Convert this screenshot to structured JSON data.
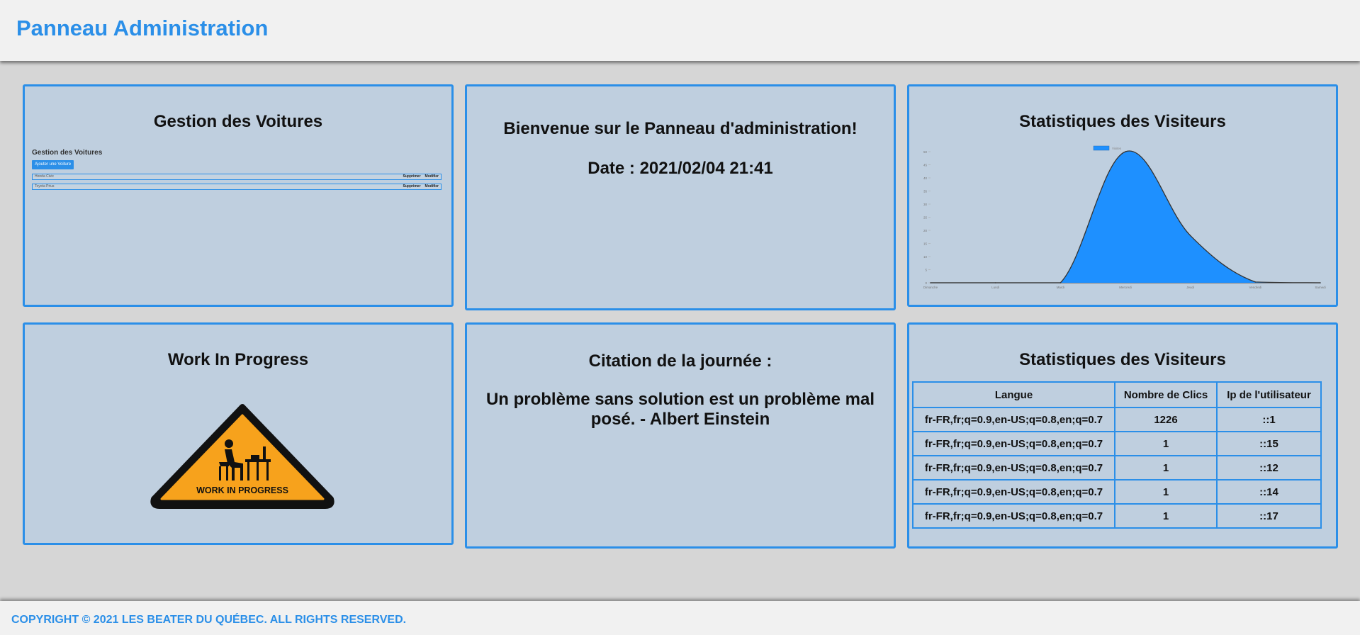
{
  "header": {
    "title": "Panneau Administration"
  },
  "cars_card": {
    "title": "Gestion des Voitures",
    "embedded": {
      "title": "Gestion des Voitures",
      "add_button": "Ajouter une Voiture",
      "rows": [
        {
          "name": "Honda Civic",
          "delete": "Supprimer",
          "edit": "Modifier"
        },
        {
          "name": "Toyota Prius",
          "delete": "Supprimer",
          "edit": "Modifier"
        }
      ]
    }
  },
  "welcome_card": {
    "title": "Bienvenue sur le Panneau d'administration!",
    "date": "Date : 2021/02/04 21:41"
  },
  "chart_card": {
    "title": "Statistiques des Visiteurs"
  },
  "chart_data": {
    "type": "area",
    "categories": [
      "Dimanche",
      "Lundi",
      "Mardi",
      "Mercredi",
      "Jeudi",
      "Vendredi",
      "Samedi"
    ],
    "series": [
      {
        "name": "Visites",
        "values": [
          0,
          0,
          0,
          50,
          18,
          0.3,
          0
        ]
      }
    ],
    "ylim": [
      0,
      50
    ],
    "yticks": [
      0,
      5,
      10,
      15,
      20,
      25,
      30,
      35,
      40,
      45,
      50
    ],
    "grid": false,
    "legend": "top",
    "fill_color": "#1e90ff"
  },
  "wip_card": {
    "title": "Work In Progress",
    "sign_text": "WORK IN PROGRESS"
  },
  "quote_card": {
    "title": "Citation de la journée :",
    "quote": "Un problème sans solution est un problème mal posé. - Albert Einstein"
  },
  "stats_card": {
    "title": "Statistiques des Visiteurs",
    "headers": [
      "Langue",
      "Nombre de Clics",
      "Ip de l'utilisateur"
    ],
    "rows": [
      [
        "fr-FR,fr;q=0.9,en-US;q=0.8,en;q=0.7",
        "1226",
        "::1"
      ],
      [
        "fr-FR,fr;q=0.9,en-US;q=0.8,en;q=0.7",
        "1",
        "::15"
      ],
      [
        "fr-FR,fr;q=0.9,en-US;q=0.8,en;q=0.7",
        "1",
        "::12"
      ],
      [
        "fr-FR,fr;q=0.9,en-US;q=0.8,en;q=0.7",
        "1",
        "::14"
      ],
      [
        "fr-FR,fr;q=0.9,en-US;q=0.8,en;q=0.7",
        "1",
        "::17"
      ]
    ]
  },
  "footer": {
    "copyright": "COPYRIGHT © 2021 LES BEATER DU QUÉBEC. ALL RIGHTS RESERVED."
  },
  "colors": {
    "accent": "#2b8fe8",
    "card_bg": "#bfcfdf",
    "sign_orange": "#f7a21c"
  }
}
